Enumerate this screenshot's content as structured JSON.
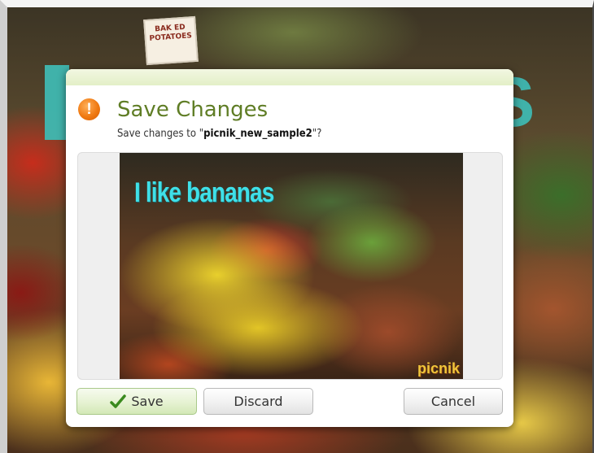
{
  "background": {
    "sign_text": "BAK ED POTATOES",
    "title_fragment_right": "S"
  },
  "dialog": {
    "title": "Save Changes",
    "subtitle_prefix": "Save changes to \"",
    "filename": "picnik_new_sample2",
    "subtitle_suffix": "\"?",
    "icon": "warning-icon",
    "preview": {
      "caption": "I like bananas",
      "watermark": "picnik"
    },
    "buttons": {
      "save_label": "Save",
      "discard_label": "Discard",
      "cancel_label": "Cancel"
    }
  },
  "colors": {
    "title": "#5f7d25",
    "accent_teal": "#3fb8b1",
    "caption": "#3fe0e8",
    "warning": "#f07a12"
  }
}
